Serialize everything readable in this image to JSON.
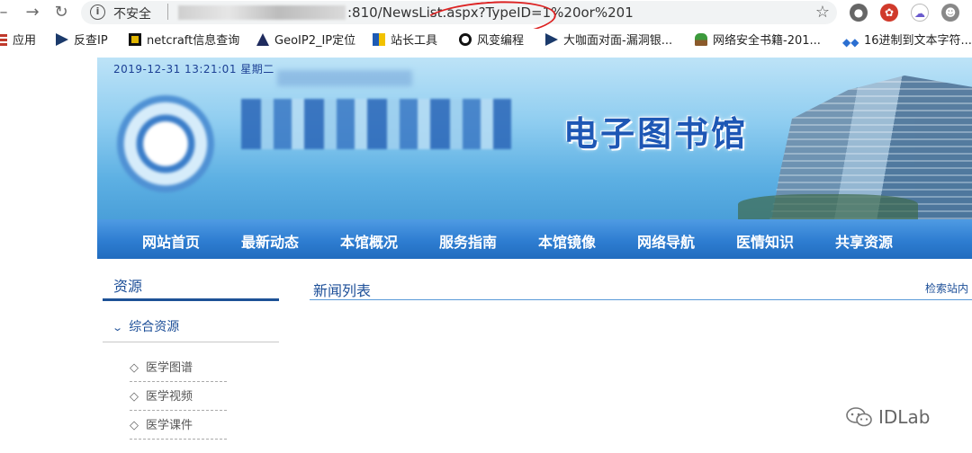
{
  "browser": {
    "security_label": "不安全",
    "url_visible": ":810/NewsList.aspx?TypeID=1%20or%201",
    "icons": [
      "back-arrow-icon",
      "forward-arrow-icon",
      "reload-icon",
      "info-icon",
      "star-icon"
    ]
  },
  "bookmarks": [
    {
      "label": "应用",
      "icon": "apps-grid-icon"
    },
    {
      "label": "反查IP",
      "icon": "bookmark-icon"
    },
    {
      "label": "netcraft信息查询",
      "icon": "netcraft-icon"
    },
    {
      "label": "GeoIP2_IP定位",
      "icon": "geoip-icon"
    },
    {
      "label": "站长工具",
      "icon": "toolbox-icon"
    },
    {
      "label": "风变编程",
      "icon": "panda-icon"
    },
    {
      "label": "大咖面对面-漏洞银...",
      "icon": "bookmark-icon"
    },
    {
      "label": "网络安全书籍-201...",
      "icon": "plant-icon"
    },
    {
      "label": "16进制到文本字符...",
      "icon": "code-icon"
    }
  ],
  "site": {
    "date": "2019-12-31 13:21:01 星期二",
    "title": "电子图书馆",
    "nav": [
      "网站首页",
      "最新动态",
      "本馆概况",
      "服务指南",
      "本馆镜像",
      "网络导航",
      "医情知识",
      "共享资源"
    ],
    "sidebar": {
      "title": "资源",
      "category": "综合资源",
      "links": [
        "医学图谱",
        "医学视频",
        "医学课件"
      ]
    },
    "content": {
      "heading": "新闻列表",
      "search_label": "检索站内"
    }
  },
  "watermark": "IDLab",
  "colors": {
    "nav_blue": "#2e7dd1",
    "title_blue": "#1e57b5",
    "annotation_red": "#d22222"
  }
}
